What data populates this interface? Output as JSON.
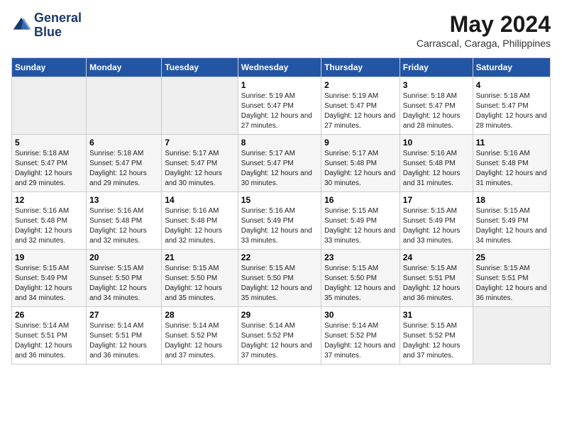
{
  "logo": {
    "line1": "General",
    "line2": "Blue"
  },
  "title": "May 2024",
  "subtitle": "Carrascal, Caraga, Philippines",
  "header_days": [
    "Sunday",
    "Monday",
    "Tuesday",
    "Wednesday",
    "Thursday",
    "Friday",
    "Saturday"
  ],
  "weeks": [
    [
      {
        "day": "",
        "sunrise": "",
        "sunset": "",
        "daylight": "",
        "empty": true
      },
      {
        "day": "",
        "sunrise": "",
        "sunset": "",
        "daylight": "",
        "empty": true
      },
      {
        "day": "",
        "sunrise": "",
        "sunset": "",
        "daylight": "",
        "empty": true
      },
      {
        "day": "1",
        "sunrise": "Sunrise: 5:19 AM",
        "sunset": "Sunset: 5:47 PM",
        "daylight": "Daylight: 12 hours and 27 minutes."
      },
      {
        "day": "2",
        "sunrise": "Sunrise: 5:19 AM",
        "sunset": "Sunset: 5:47 PM",
        "daylight": "Daylight: 12 hours and 27 minutes."
      },
      {
        "day": "3",
        "sunrise": "Sunrise: 5:18 AM",
        "sunset": "Sunset: 5:47 PM",
        "daylight": "Daylight: 12 hours and 28 minutes."
      },
      {
        "day": "4",
        "sunrise": "Sunrise: 5:18 AM",
        "sunset": "Sunset: 5:47 PM",
        "daylight": "Daylight: 12 hours and 28 minutes."
      }
    ],
    [
      {
        "day": "5",
        "sunrise": "Sunrise: 5:18 AM",
        "sunset": "Sunset: 5:47 PM",
        "daylight": "Daylight: 12 hours and 29 minutes."
      },
      {
        "day": "6",
        "sunrise": "Sunrise: 5:18 AM",
        "sunset": "Sunset: 5:47 PM",
        "daylight": "Daylight: 12 hours and 29 minutes."
      },
      {
        "day": "7",
        "sunrise": "Sunrise: 5:17 AM",
        "sunset": "Sunset: 5:47 PM",
        "daylight": "Daylight: 12 hours and 30 minutes."
      },
      {
        "day": "8",
        "sunrise": "Sunrise: 5:17 AM",
        "sunset": "Sunset: 5:47 PM",
        "daylight": "Daylight: 12 hours and 30 minutes."
      },
      {
        "day": "9",
        "sunrise": "Sunrise: 5:17 AM",
        "sunset": "Sunset: 5:48 PM",
        "daylight": "Daylight: 12 hours and 30 minutes."
      },
      {
        "day": "10",
        "sunrise": "Sunrise: 5:16 AM",
        "sunset": "Sunset: 5:48 PM",
        "daylight": "Daylight: 12 hours and 31 minutes."
      },
      {
        "day": "11",
        "sunrise": "Sunrise: 5:16 AM",
        "sunset": "Sunset: 5:48 PM",
        "daylight": "Daylight: 12 hours and 31 minutes."
      }
    ],
    [
      {
        "day": "12",
        "sunrise": "Sunrise: 5:16 AM",
        "sunset": "Sunset: 5:48 PM",
        "daylight": "Daylight: 12 hours and 32 minutes."
      },
      {
        "day": "13",
        "sunrise": "Sunrise: 5:16 AM",
        "sunset": "Sunset: 5:48 PM",
        "daylight": "Daylight: 12 hours and 32 minutes."
      },
      {
        "day": "14",
        "sunrise": "Sunrise: 5:16 AM",
        "sunset": "Sunset: 5:48 PM",
        "daylight": "Daylight: 12 hours and 32 minutes."
      },
      {
        "day": "15",
        "sunrise": "Sunrise: 5:16 AM",
        "sunset": "Sunset: 5:49 PM",
        "daylight": "Daylight: 12 hours and 33 minutes."
      },
      {
        "day": "16",
        "sunrise": "Sunrise: 5:15 AM",
        "sunset": "Sunset: 5:49 PM",
        "daylight": "Daylight: 12 hours and 33 minutes."
      },
      {
        "day": "17",
        "sunrise": "Sunrise: 5:15 AM",
        "sunset": "Sunset: 5:49 PM",
        "daylight": "Daylight: 12 hours and 33 minutes."
      },
      {
        "day": "18",
        "sunrise": "Sunrise: 5:15 AM",
        "sunset": "Sunset: 5:49 PM",
        "daylight": "Daylight: 12 hours and 34 minutes."
      }
    ],
    [
      {
        "day": "19",
        "sunrise": "Sunrise: 5:15 AM",
        "sunset": "Sunset: 5:49 PM",
        "daylight": "Daylight: 12 hours and 34 minutes."
      },
      {
        "day": "20",
        "sunrise": "Sunrise: 5:15 AM",
        "sunset": "Sunset: 5:50 PM",
        "daylight": "Daylight: 12 hours and 34 minutes."
      },
      {
        "day": "21",
        "sunrise": "Sunrise: 5:15 AM",
        "sunset": "Sunset: 5:50 PM",
        "daylight": "Daylight: 12 hours and 35 minutes."
      },
      {
        "day": "22",
        "sunrise": "Sunrise: 5:15 AM",
        "sunset": "Sunset: 5:50 PM",
        "daylight": "Daylight: 12 hours and 35 minutes."
      },
      {
        "day": "23",
        "sunrise": "Sunrise: 5:15 AM",
        "sunset": "Sunset: 5:50 PM",
        "daylight": "Daylight: 12 hours and 35 minutes."
      },
      {
        "day": "24",
        "sunrise": "Sunrise: 5:15 AM",
        "sunset": "Sunset: 5:51 PM",
        "daylight": "Daylight: 12 hours and 36 minutes."
      },
      {
        "day": "25",
        "sunrise": "Sunrise: 5:15 AM",
        "sunset": "Sunset: 5:51 PM",
        "daylight": "Daylight: 12 hours and 36 minutes."
      }
    ],
    [
      {
        "day": "26",
        "sunrise": "Sunrise: 5:14 AM",
        "sunset": "Sunset: 5:51 PM",
        "daylight": "Daylight: 12 hours and 36 minutes."
      },
      {
        "day": "27",
        "sunrise": "Sunrise: 5:14 AM",
        "sunset": "Sunset: 5:51 PM",
        "daylight": "Daylight: 12 hours and 36 minutes."
      },
      {
        "day": "28",
        "sunrise": "Sunrise: 5:14 AM",
        "sunset": "Sunset: 5:52 PM",
        "daylight": "Daylight: 12 hours and 37 minutes."
      },
      {
        "day": "29",
        "sunrise": "Sunrise: 5:14 AM",
        "sunset": "Sunset: 5:52 PM",
        "daylight": "Daylight: 12 hours and 37 minutes."
      },
      {
        "day": "30",
        "sunrise": "Sunrise: 5:14 AM",
        "sunset": "Sunset: 5:52 PM",
        "daylight": "Daylight: 12 hours and 37 minutes."
      },
      {
        "day": "31",
        "sunrise": "Sunrise: 5:15 AM",
        "sunset": "Sunset: 5:52 PM",
        "daylight": "Daylight: 12 hours and 37 minutes."
      },
      {
        "day": "",
        "sunrise": "",
        "sunset": "",
        "daylight": "",
        "empty": true
      }
    ]
  ]
}
